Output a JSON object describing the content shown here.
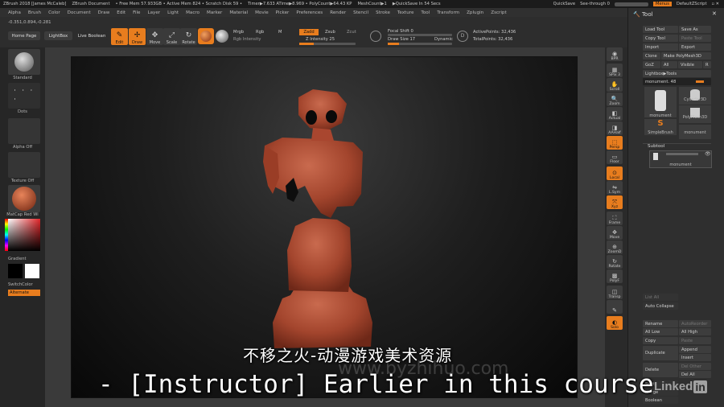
{
  "titlebar": {
    "items": [
      "ZBrush 2018 [James McCaleb]",
      "ZBrush Document",
      "• Free Mem 57.933GB • Active Mem 824 • Scratch Disk 59 •",
      "Timer▶7.633 ATime▶8.969 • PolyCount▶64.43 KP",
      "MeshCount▶1",
      "▶QuickSave In 54 Secs"
    ],
    "quicksave": "QuickSave",
    "see_through": "See-through 0",
    "menus": "Menus",
    "default_script": "DefaultZScript"
  },
  "menubar": [
    "Alpha",
    "Brush",
    "Color",
    "Document",
    "Draw",
    "Edit",
    "File",
    "Layer",
    "Light",
    "Macro",
    "Marker",
    "Material",
    "Movie",
    "Picker",
    "Preferences",
    "Render",
    "Stencil",
    "Stroke",
    "Texture",
    "Tool",
    "Transform",
    "Zplugin",
    "Zscript"
  ],
  "shelf": {
    "coords": "-0.351,0.894,-0.281",
    "home_page": "Home Page",
    "lightbox": "LightBox",
    "live_boolean": "Live Boolean",
    "modes": [
      "Edit",
      "Draw",
      "Move",
      "Scale",
      "Rotate"
    ],
    "mrgb": "Mrgb",
    "rgb": "Rgb",
    "m": "M",
    "zadd": "Zadd",
    "zsub": "Zsub",
    "zcut": "Zcut",
    "rgb_intensity": "Rgb Intensity",
    "z_intensity": "Z Intensity 25",
    "focal_shift": "Focal Shift 0",
    "draw_size": "Draw Size 17",
    "dynamic": "Dynamic",
    "active_points": "ActivePoints: 32,436",
    "total_points": "TotalPoints: 32,436",
    "z_intensity_value": 0.25,
    "draw_size_value": 0.17
  },
  "leftshelf": {
    "standard": "Standard",
    "dots": "Dots",
    "alpha_off": "Alpha Off",
    "texture_off": "Texture Off",
    "matcap": "MatCap Red Wi",
    "gradient": "Gradient",
    "switch_color": "SwitchColor",
    "alternate": "Alternate"
  },
  "rightrail": [
    {
      "label": "BPR",
      "icon": "bpr-icon"
    },
    {
      "label": "SPix 3",
      "icon": "spix-icon"
    },
    {
      "label": "Scroll",
      "icon": "scroll-icon"
    },
    {
      "label": "Zoom",
      "icon": "zoom-icon"
    },
    {
      "label": "Actual",
      "icon": "actual-icon"
    },
    {
      "label": "AAHalf",
      "icon": "aahalf-icon"
    },
    {
      "label": "Persp",
      "icon": "persp-icon"
    },
    {
      "label": "Floor",
      "icon": "floor-icon"
    },
    {
      "label": "Local",
      "icon": "local-icon"
    },
    {
      "label": "L.Sym",
      "icon": "lsym-icon"
    },
    {
      "label": "Xyz",
      "icon": "xyz-icon"
    },
    {
      "label": "Frame",
      "icon": "frame-icon"
    },
    {
      "label": "Move",
      "icon": "move-icon"
    },
    {
      "label": "ZoomD",
      "icon": "zoomd-icon"
    },
    {
      "label": "Rotate",
      "icon": "rotate-icon"
    },
    {
      "label": "PolyF",
      "icon": "polyf-icon"
    },
    {
      "label": "Transp",
      "icon": "transp-icon"
    },
    {
      "label": "",
      "icon": "ghost-icon"
    },
    {
      "label": "Solo",
      "icon": "solo-icon"
    }
  ],
  "toolpanel": {
    "title": "Tool",
    "load_tool": "Load Tool",
    "save_as": "Save As",
    "copy_tool": "Copy Tool",
    "paste_tool": "Paste Tool",
    "import": "Import",
    "export": "Export",
    "clone": "Clone",
    "make_polymesh": "Make PolyMesh3D",
    "goz": "GoZ",
    "all": "All",
    "visible": "Visible",
    "r": "R",
    "lightbox_tools": "Lightbox▶Tools",
    "monument_slider": "monument. 48",
    "thumbs": [
      "monument",
      "Cylinder3D",
      "SimpleBrush",
      "PolyMesh3D",
      "monument"
    ],
    "subtool": "Subtool",
    "subtool_item": "monument",
    "list_all": "List All",
    "auto_collapse": "Auto Collapse",
    "rename": "Rename",
    "autoreorder": "AutoReorder",
    "all_low": "All Low",
    "all_high": "All High",
    "copy": "Copy",
    "paste": "Paste",
    "duplicate": "Duplicate",
    "append": "Append",
    "insert": "Insert",
    "delete": "Delete",
    "del_other": "Del Other",
    "del_all": "Del All",
    "split": "Split",
    "merge": "Merge",
    "boolean": "Boolean"
  },
  "overlay": {
    "cn_watermark": "不移之火-动漫游戏美术资源",
    "url_watermark": "www.byzhihuo.com",
    "subtitle": "- [Instructor] Earlier in this course",
    "linkedin": "Linked",
    "linkedin_in": "in"
  }
}
